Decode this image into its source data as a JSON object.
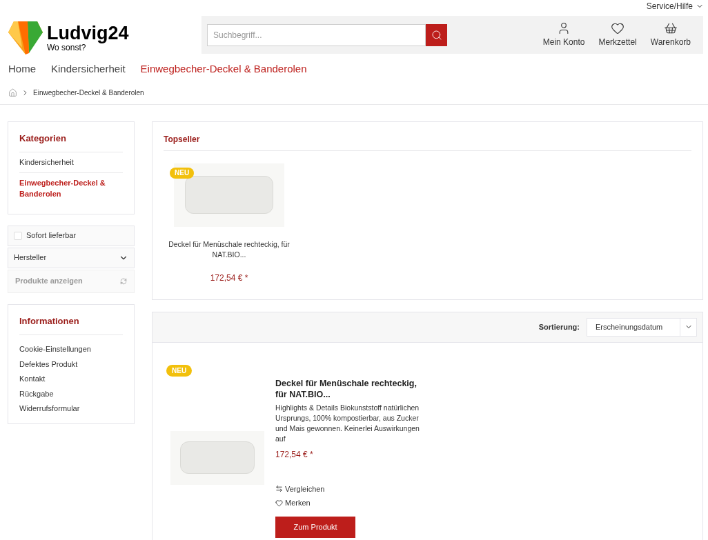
{
  "top_bar": {
    "service_menu": "Service/Hilfe"
  },
  "header": {
    "logo": {
      "name": "Ludvig24",
      "tagline": "Wo sonst?"
    },
    "search": {
      "placeholder": "Suchbegriff..."
    },
    "actions": [
      {
        "kind": "account",
        "label": "Mein Konto"
      },
      {
        "kind": "wishlist",
        "label": "Merkzettel"
      },
      {
        "kind": "cart",
        "label": "Warenkorb"
      }
    ]
  },
  "nav": [
    {
      "label": "Home",
      "selected": false
    },
    {
      "label": "Kindersicherheit",
      "selected": false
    },
    {
      "label": "Einwegbecher-Deckel & Banderolen",
      "selected": true
    }
  ],
  "breadcrumb": [
    "Einwegbecher-Deckel & Banderolen"
  ],
  "sidebar": {
    "categories": {
      "title": "Kategorien",
      "items": [
        {
          "label": "Kindersicherheit",
          "selected": false
        },
        {
          "label": "Einwegbecher-Deckel & Banderolen",
          "selected": true
        }
      ]
    },
    "filters": {
      "instock": {
        "label": "Sofort lieferbar",
        "checked": false
      },
      "manufacturer": "Hersteller",
      "apply": "Produkte anzeigen"
    },
    "info": {
      "title": "Informationen",
      "items": [
        "Cookie-Einstellungen",
        "Defektes Produkt",
        "Kontakt",
        "Rückgabe",
        "Widerrufsformular"
      ]
    }
  },
  "topseller": {
    "title": "Topseller",
    "products": [
      {
        "badge": "NEU",
        "name": "Deckel für Menüschale rechteckig, für NAT.BIO...",
        "price": "172,54 € *"
      }
    ]
  },
  "listing": {
    "sort_label": "Sortierung:",
    "sort_value": "Erscheinungsdatum",
    "products": [
      {
        "badge": "NEU",
        "name": "Deckel für Menüschale rechteckig, für NAT.BIO...",
        "description": "Highlights & Details Biokunststoff natürlichen Ursprungs, 100% kompostierbar, aus Zucker und Mais gewonnen. Keinerlei Auswirkungen auf",
        "price": "172,54 € *",
        "compare": "Vergleichen",
        "remember": "Merken",
        "button": "Zum Produkt"
      }
    ]
  }
}
